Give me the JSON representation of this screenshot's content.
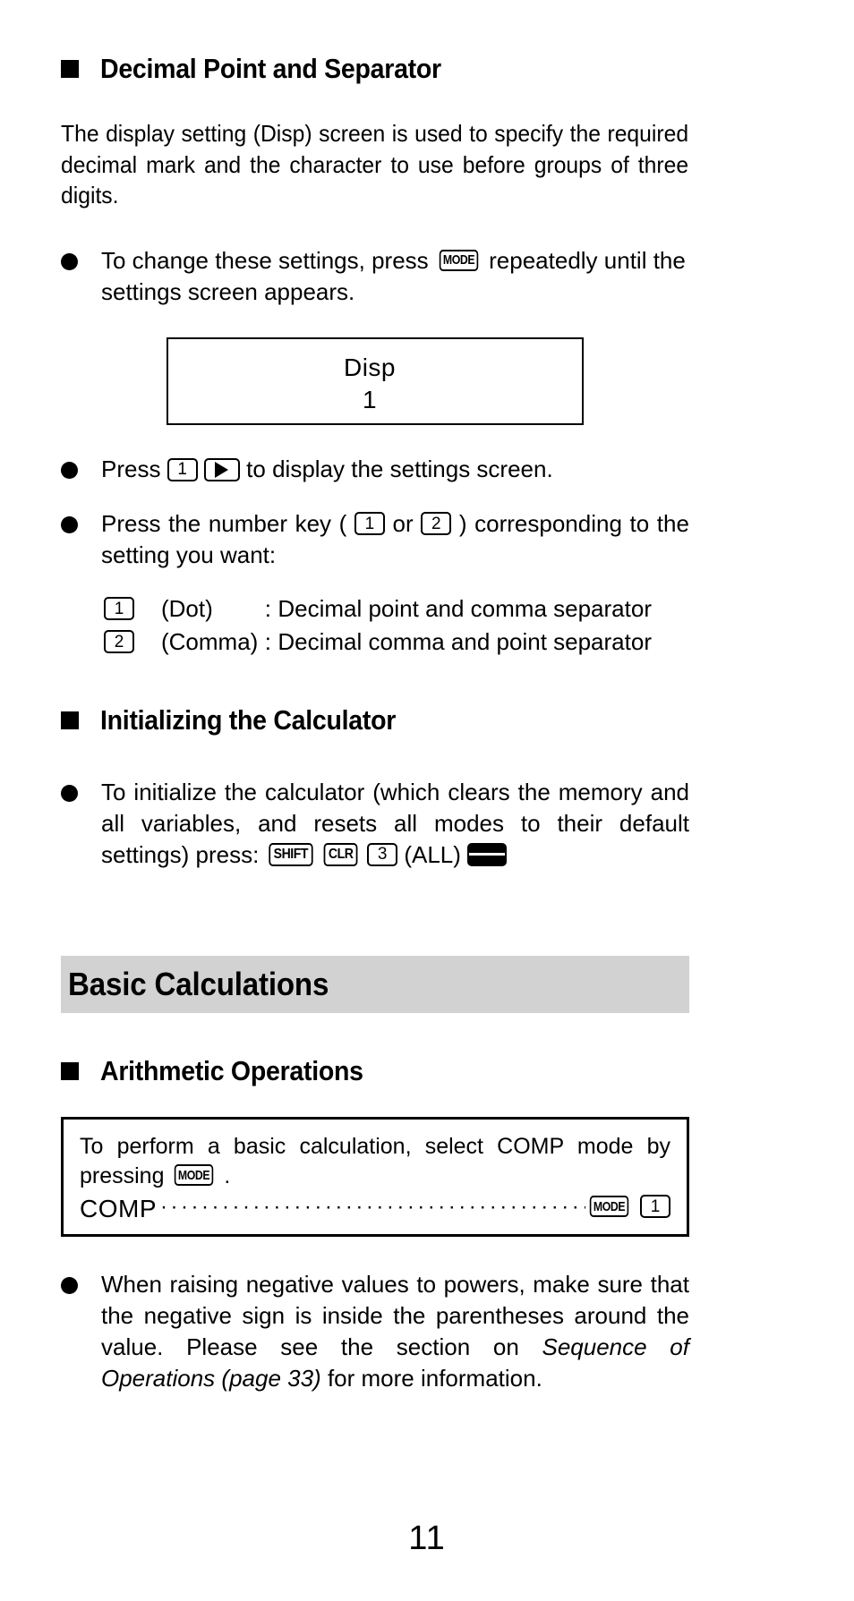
{
  "page": {
    "number": "11"
  },
  "sections": [
    {
      "id": "decimal-point-separator",
      "heading": "Decimal Point and Separator",
      "intro": "The display setting (Disp) screen is used to specify the required decimal mark and the character to use before groups of three digits.",
      "bullet1": {
        "text_before": "To change these settings, press",
        "key": "MODE",
        "text_after": "repeatedly  until the settings screen appears."
      },
      "lcd": {
        "line1": "Disp",
        "line2": "1"
      },
      "bullet2": {
        "text_before": "Press",
        "key1": "1",
        "key2": "right-arrow",
        "text_after": "to display the settings screen."
      },
      "bullet3": {
        "text_a": "Press the number key (",
        "key1": "1",
        "text_or": "or",
        "key2": "2",
        "text_b": ") corresponding to the setting you want:"
      },
      "options": [
        {
          "key": "1",
          "label": "(Dot)",
          "colon": ":",
          "description": "Decimal point and comma separator"
        },
        {
          "key": "2",
          "label": "(Comma)",
          "colon": ":",
          "description": "Decimal comma and point separator"
        }
      ]
    },
    {
      "id": "initializing-calculator",
      "heading": "Initializing the Calculator",
      "bullet1": {
        "text_before": "To initialize the calculator (which clears the memory and all variables, and resets all modes to their default settings) press:",
        "key1": "SHIFT",
        "key2": "CLR",
        "key3": "3",
        "text_mid": "(ALL)",
        "key4": "="
      }
    }
  ],
  "band": {
    "title": "Basic Calculations"
  },
  "arithmetic": {
    "heading": "Arithmetic Operations",
    "mode_box": {
      "text_a": "To perform a basic calculation, select COMP mode by pressing",
      "key_mode": "MODE",
      "text_b": ".",
      "leader_label": "COMP",
      "leader_dots": "·······································································",
      "leader_key1": "MODE",
      "leader_key2": "1"
    },
    "note": {
      "part1": "When raising negative values to powers, make sure that the negative sign is inside the parentheses around the value. Please see the section on ",
      "italic": "Sequence of Operations (page 33)",
      "part2": " for more information."
    }
  }
}
